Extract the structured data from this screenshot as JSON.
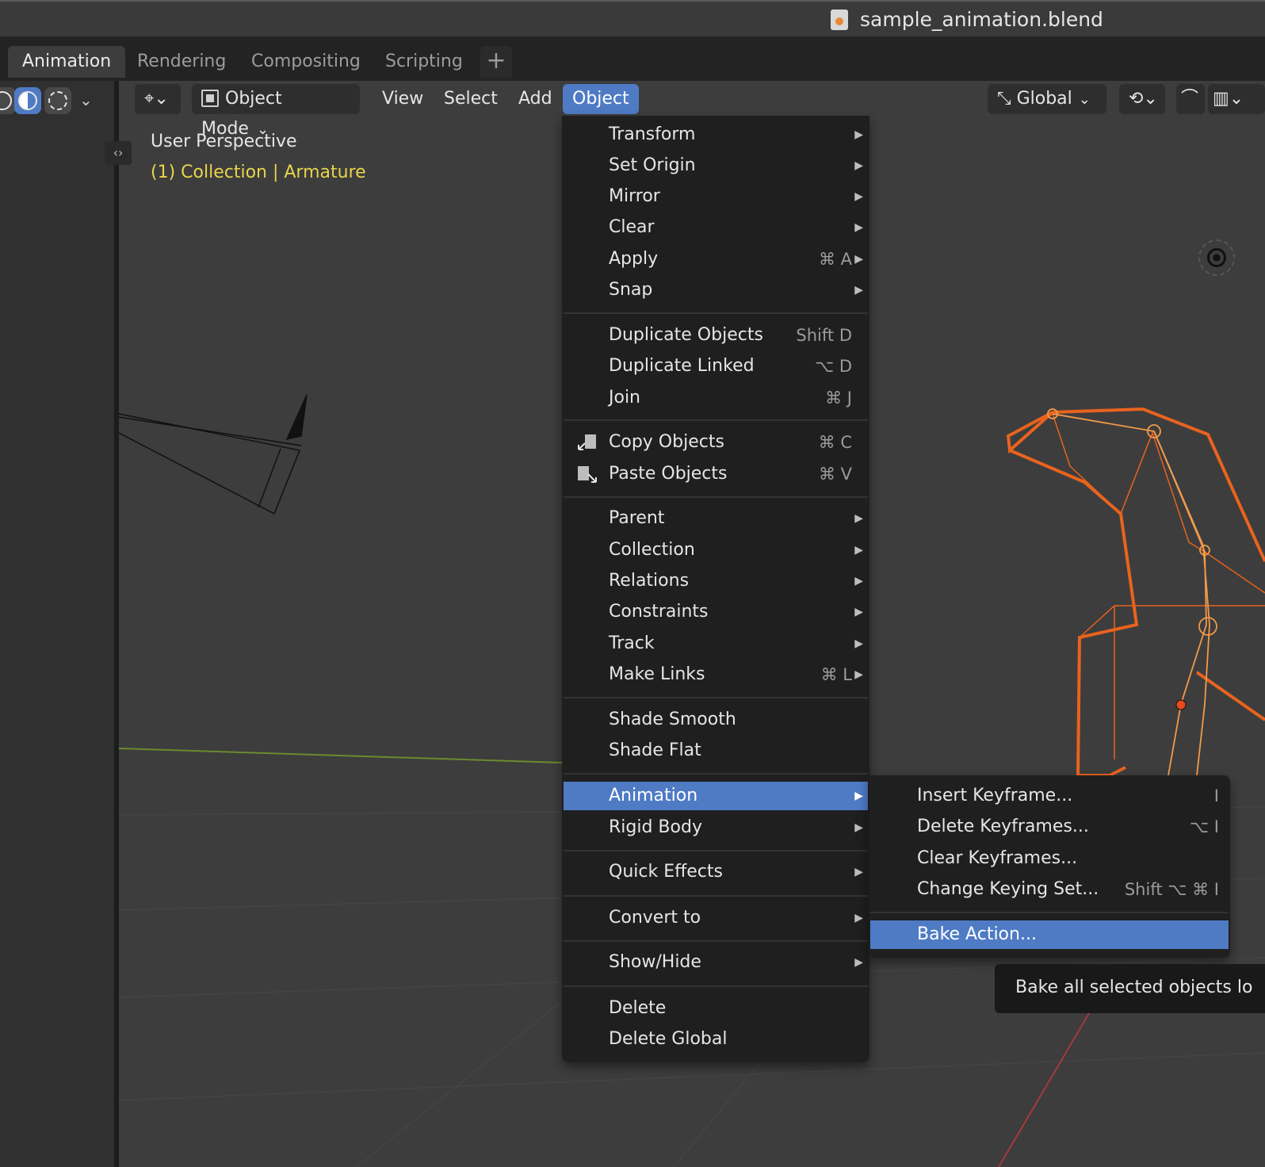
{
  "window": {
    "title": "sample_animation.blend"
  },
  "workspace_tabs": [
    {
      "label": "Animation",
      "active": true
    },
    {
      "label": "Rendering",
      "active": false
    },
    {
      "label": "Compositing",
      "active": false
    },
    {
      "label": "Scripting",
      "active": false
    }
  ],
  "add_workspace_label": "+",
  "header": {
    "mode_label": "Object Mode",
    "menus": [
      "View",
      "Select",
      "Add",
      "Object"
    ],
    "active_menu": "Object",
    "transform_orientation": "Global"
  },
  "viewport": {
    "perspective_label": "User Perspective",
    "collection_label": "(1) Collection | Armature"
  },
  "object_menu": {
    "items": [
      {
        "label": "Transform",
        "shortcut": "",
        "submenu": true
      },
      {
        "label": "Set Origin",
        "shortcut": "",
        "submenu": true
      },
      {
        "label": "Mirror",
        "shortcut": "",
        "submenu": true
      },
      {
        "label": "Clear",
        "shortcut": "",
        "submenu": true
      },
      {
        "label": "Apply",
        "shortcut": "⌘ A",
        "submenu": true
      },
      {
        "label": "Snap",
        "shortcut": "",
        "submenu": true
      },
      {
        "label": "Duplicate Objects",
        "shortcut": "Shift D",
        "submenu": false
      },
      {
        "label": "Duplicate Linked",
        "shortcut": "⌥ D",
        "submenu": false
      },
      {
        "label": "Join",
        "shortcut": "⌘ J",
        "submenu": false
      },
      {
        "label": "Copy Objects",
        "shortcut": "⌘ C",
        "submenu": false,
        "icon": "copy-icon"
      },
      {
        "label": "Paste Objects",
        "shortcut": "⌘ V",
        "submenu": false,
        "icon": "paste-icon"
      },
      {
        "label": "Parent",
        "shortcut": "",
        "submenu": true
      },
      {
        "label": "Collection",
        "shortcut": "",
        "submenu": true
      },
      {
        "label": "Relations",
        "shortcut": "",
        "submenu": true
      },
      {
        "label": "Constraints",
        "shortcut": "",
        "submenu": true
      },
      {
        "label": "Track",
        "shortcut": "",
        "submenu": true
      },
      {
        "label": "Make Links",
        "shortcut": "⌘ L",
        "submenu": true
      },
      {
        "label": "Shade Smooth",
        "shortcut": "",
        "submenu": false
      },
      {
        "label": "Shade Flat",
        "shortcut": "",
        "submenu": false
      },
      {
        "label": "Animation",
        "shortcut": "",
        "submenu": true,
        "highlighted": true
      },
      {
        "label": "Rigid Body",
        "shortcut": "",
        "submenu": true
      },
      {
        "label": "Quick Effects",
        "shortcut": "",
        "submenu": true
      },
      {
        "label": "Convert to",
        "shortcut": "",
        "submenu": true
      },
      {
        "label": "Show/Hide",
        "shortcut": "",
        "submenu": true
      },
      {
        "label": "Delete",
        "shortcut": "",
        "submenu": false
      },
      {
        "label": "Delete Global",
        "shortcut": "",
        "submenu": false
      }
    ]
  },
  "animation_submenu": {
    "items": [
      {
        "label": "Insert Keyframe...",
        "shortcut": "I"
      },
      {
        "label": "Delete Keyframes...",
        "shortcut": "⌥ I"
      },
      {
        "label": "Clear Keyframes...",
        "shortcut": ""
      },
      {
        "label": "Change Keying Set...",
        "shortcut": "Shift ⌥ ⌘ I"
      },
      {
        "label": "Bake Action...",
        "shortcut": "",
        "highlighted": true
      }
    ]
  },
  "tooltip": {
    "text": "Bake all selected objects lo"
  },
  "colors": {
    "accent": "#4f7bc5",
    "selection_orange": "#e8631e",
    "collection_text": "#e8d44a"
  }
}
